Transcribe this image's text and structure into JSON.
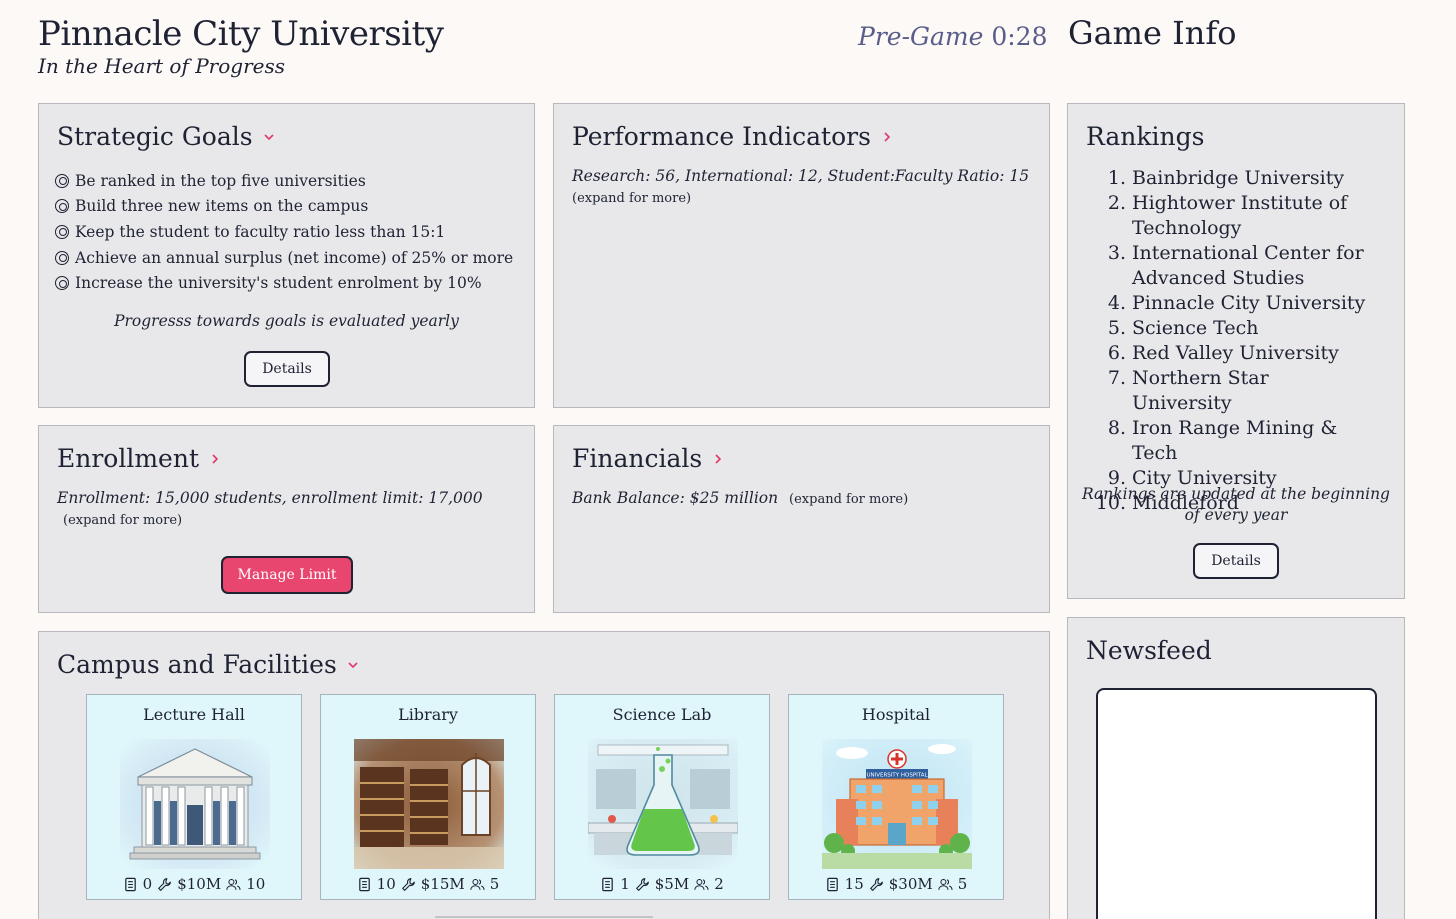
{
  "header": {
    "title": "Pinnacle City University",
    "subtitle": "In the Heart of Progress",
    "phase": "Pre-Game",
    "timer": "0:28",
    "game_info_title": "Game Info"
  },
  "strategic_goals": {
    "title": "Strategic Goals",
    "goals": [
      "Be ranked in the top five universities",
      "Build three new items on the campus",
      "Keep the student to faculty ratio less than 15:1",
      "Achieve an annual surplus (net income) of 25% or more",
      "Increase the university's student enrolment by 10%"
    ],
    "note": "Progresss towards goals is evaluated yearly",
    "details_label": "Details"
  },
  "performance": {
    "title": "Performance Indicators",
    "summary": "Research: 56, International: 12, Student:Faculty Ratio: 15",
    "more": "(expand for more)"
  },
  "enrollment": {
    "title": "Enrollment",
    "summary": "Enrollment: 15,000 students, enrollment limit: 17,000",
    "more": "(expand for more)",
    "manage_label": "Manage Limit"
  },
  "financials": {
    "title": "Financials",
    "summary": "Bank Balance: $25 million",
    "more": "(expand for more)"
  },
  "rankings": {
    "title": "Rankings",
    "items": [
      {
        "rank": "1.",
        "name": "Bainbridge University"
      },
      {
        "rank": "2.",
        "name": "Hightower Institute of Technology"
      },
      {
        "rank": "3.",
        "name": "International Center for Advanced Studies"
      },
      {
        "rank": "4.",
        "name": "Pinnacle City University"
      },
      {
        "rank": "5.",
        "name": "Science Tech"
      },
      {
        "rank": "6.",
        "name": "Red Valley University"
      },
      {
        "rank": "7.",
        "name": "Northern Star University"
      },
      {
        "rank": "8.",
        "name": "Iron Range Mining & Tech"
      },
      {
        "rank": "9.",
        "name": "City University"
      },
      {
        "rank": "10.",
        "name": "Middleford"
      }
    ],
    "note": "Rankings are updated at the beginning of every year",
    "details_label": "Details"
  },
  "newsfeed": {
    "title": "Newsfeed"
  },
  "campus": {
    "title": "Campus and Facilities",
    "facilities": [
      {
        "name": "Lecture Hall",
        "units": "0",
        "cost": "$10M",
        "staff": "10",
        "image_icon": "lecture-hall-image"
      },
      {
        "name": "Library",
        "units": "10",
        "cost": "$15M",
        "staff": "5",
        "image_icon": "library-image"
      },
      {
        "name": "Science Lab",
        "units": "1",
        "cost": "$5M",
        "staff": "2",
        "image_icon": "science-lab-image"
      },
      {
        "name": "Hospital",
        "units": "15",
        "cost": "$30M",
        "staff": "5",
        "image_icon": "hospital-image",
        "sign_text": "UNIVERSITY HOSPITAL"
      }
    ]
  },
  "colors": {
    "accent": "#e8466f",
    "chevron": "#e0396a",
    "panel_bg": "#e8e8ea",
    "card_bg": "#dff6fb",
    "text": "#1e2233",
    "timer": "#5a5c8a"
  }
}
